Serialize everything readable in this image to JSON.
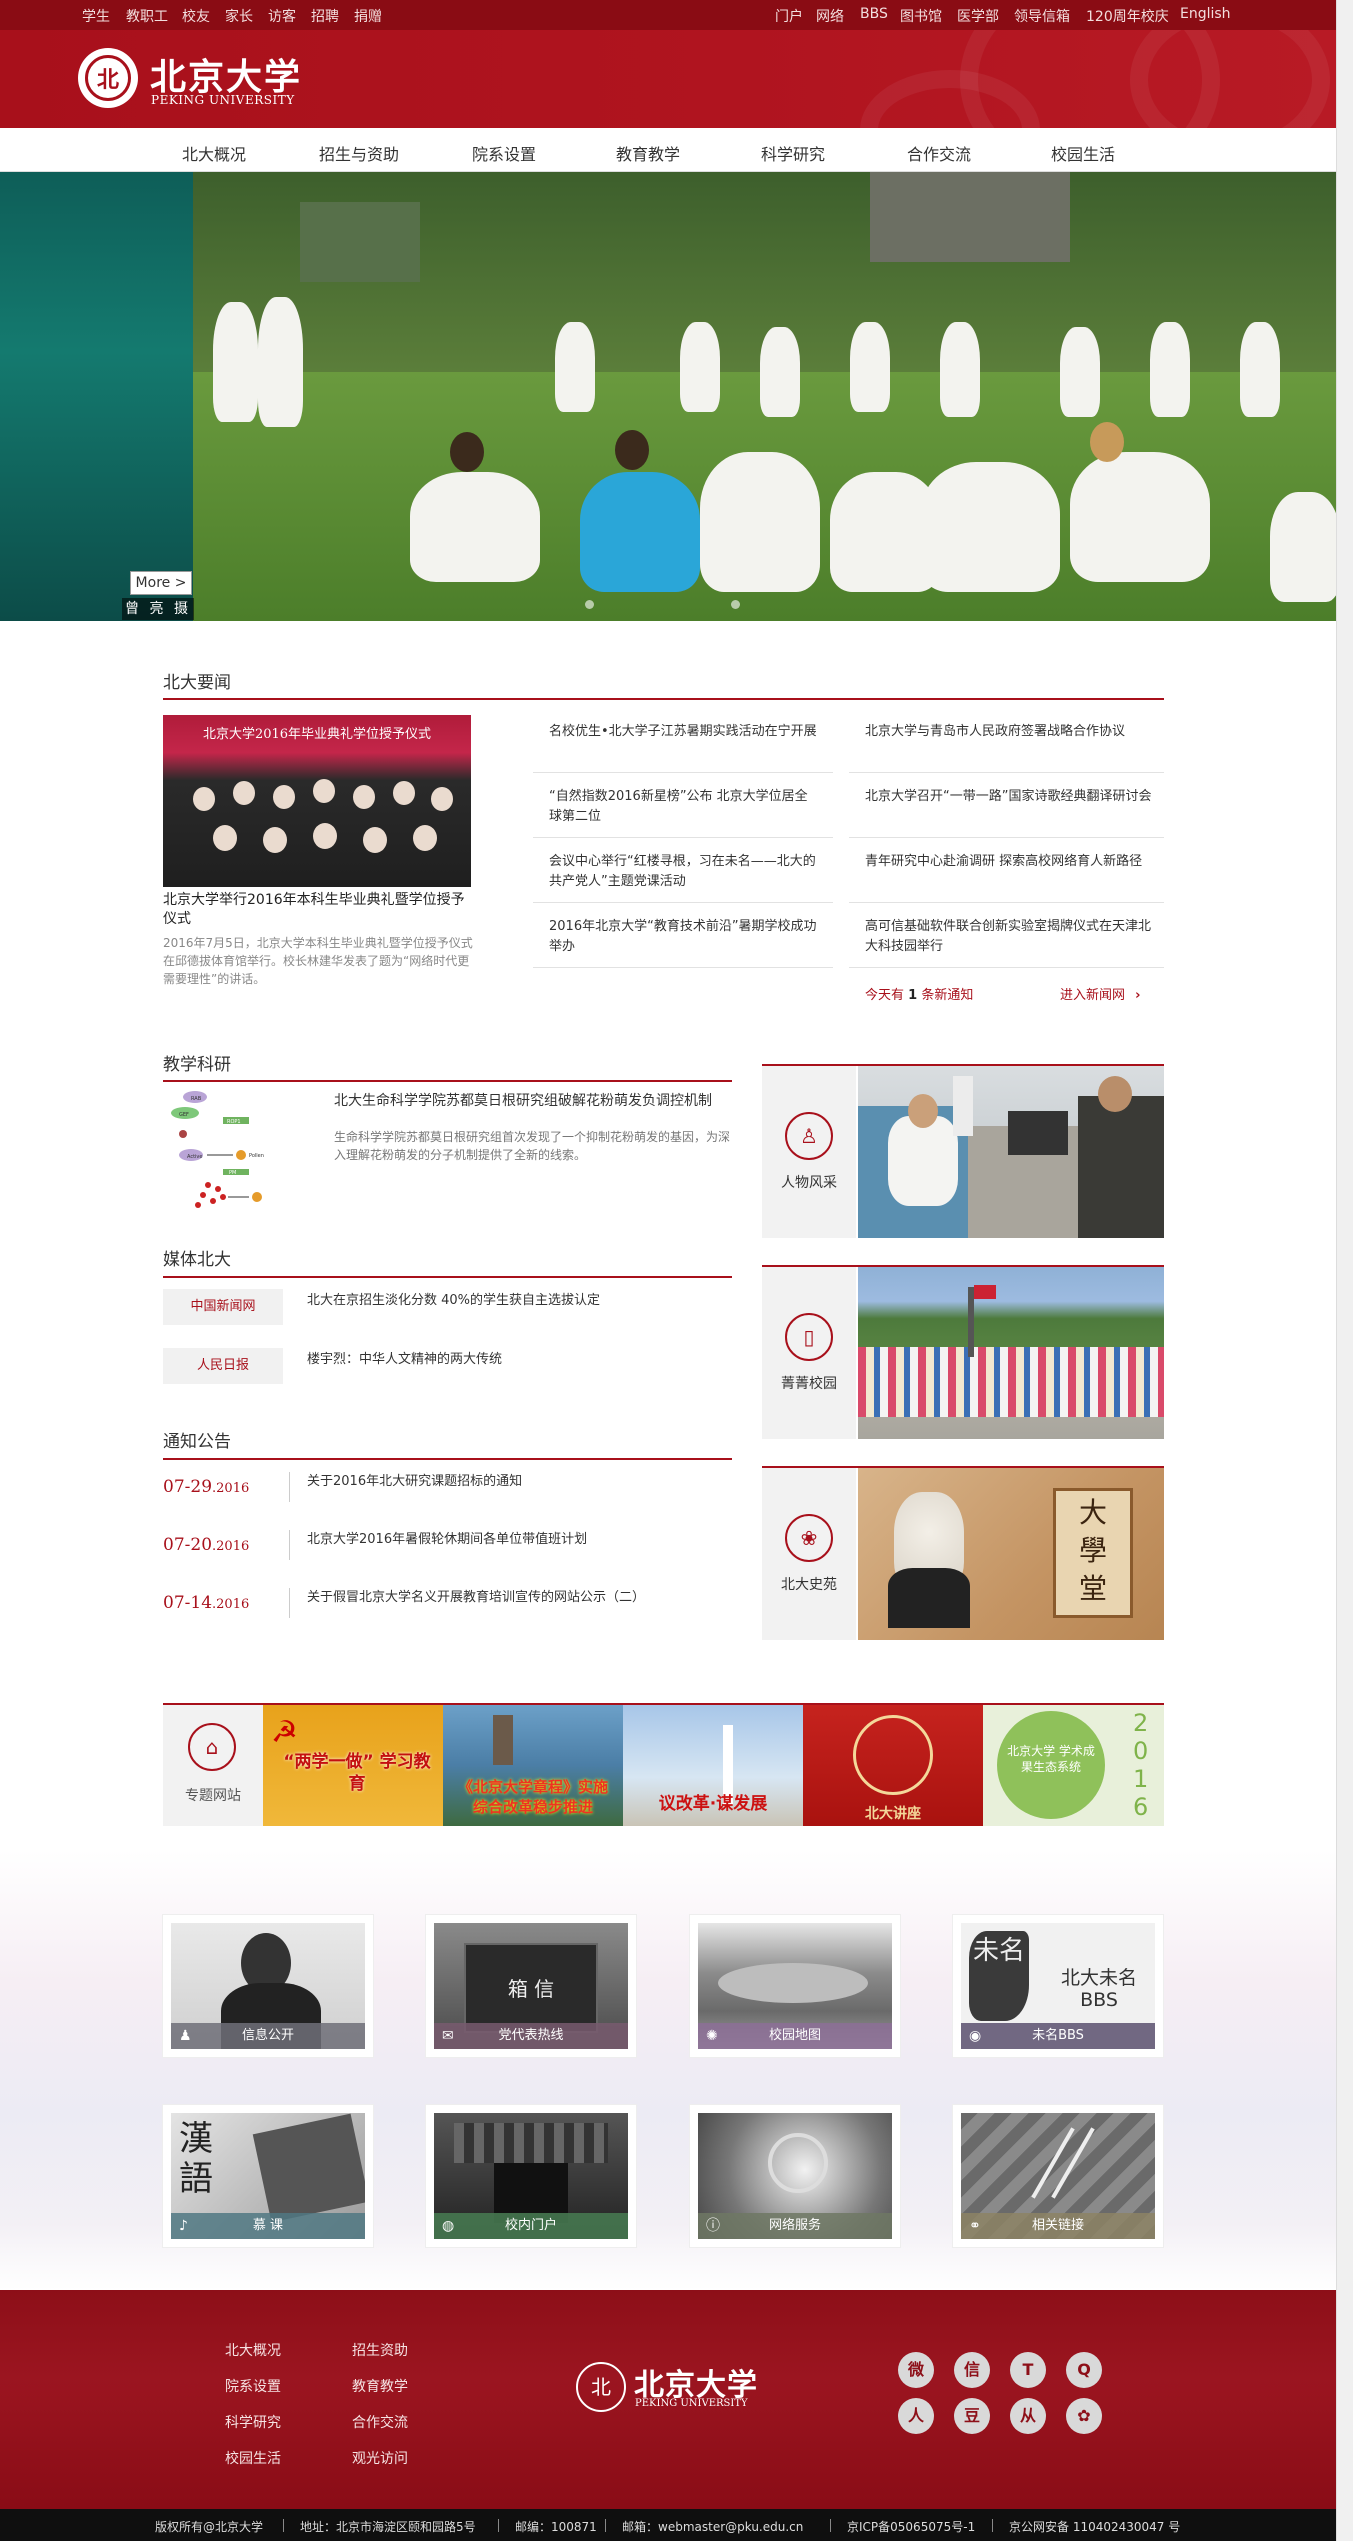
{
  "topbar": {
    "left": [
      "学生",
      "教职工",
      "校友",
      "家长",
      "访客",
      "招聘",
      "捐赠"
    ],
    "right": [
      "门户",
      "网络",
      "BBS",
      "图书馆",
      "医学部",
      "领导信箱",
      "120周年校庆",
      "English"
    ]
  },
  "logo": {
    "cn": "北京大学",
    "en": "PEKING UNIVERSITY",
    "seal": "北"
  },
  "nav": [
    "北大概况",
    "招生与资助",
    "院系设置",
    "教育教学",
    "科学研究",
    "合作交流",
    "校园生活"
  ],
  "banner": {
    "more": "More >",
    "photographer": "曾 亮 摄"
  },
  "news": {
    "title": "北大要闻",
    "image_caption": "北京大学2016年毕业典礼学位授予仪式",
    "lead_title": "北京大学举行2016年本科生毕业典礼暨学位授予仪式",
    "lead_desc": "2016年7月5日，北京大学本科生毕业典礼暨学位授予仪式在邱德拔体育馆举行。校长林建华发表了题为“网络时代更需要理性”的讲话。",
    "items_left": [
      "名校优生•北大学子江苏暑期实践活动在宁开展",
      "“自然指数2016新星榜”公布 北京大学位居全球第二位",
      "会议中心举行“红楼寻根，习在未名——北大的共产党人”主题党课活动",
      "2016年北京大学“教育技术前沿”暑期学校成功举办"
    ],
    "items_right": [
      "北京大学与青岛市人民政府签署战略合作协议",
      "北京大学召开“一带一路”国家诗歌经典翻译研讨会",
      "青年研究中心赴渝调研 探索高校网络育人新路径",
      "高可信基础软件联合创新实验室揭牌仪式在天津北大科技园举行"
    ],
    "today_prefix": "今天有",
    "today_count": "1",
    "today_suffix": "条新通知",
    "enter": "进入新闻网"
  },
  "teaching": {
    "title": "教学科研",
    "item_title": "北大生命科学学院苏都莫日根研究组破解花粉萌发负调控机制",
    "item_desc": "生命科学学院苏都莫日根研究组首次发现了一个抑制花粉萌发的基因，为深入理解花粉萌发的分子机制提供了全新的线索。",
    "diagram_labels": [
      "RAB",
      "GEF",
      "ROP1",
      "Active",
      "Pollen",
      "PM"
    ]
  },
  "media": {
    "title": "媒体北大",
    "items": [
      {
        "tag": "中国新闻网",
        "text": "北大在京招生淡化分数 40%的学生获自主选拔认定"
      },
      {
        "tag": "人民日报",
        "text": "楼宇烈：中华人文精神的两大传统"
      }
    ]
  },
  "notices": {
    "title": "通知公告",
    "items": [
      {
        "md": "07-29",
        "year": ".2016",
        "text": "关于2016年北大研究课题招标的通知"
      },
      {
        "md": "07-20",
        "year": ".2016",
        "text": "北京大学2016年暑假轮休期间各单位带值班计划"
      },
      {
        "md": "07-14",
        "year": ".2016",
        "text": "关于假冒北京大学名义开展教育培训宣传的网站公示（二）"
      }
    ]
  },
  "features": [
    {
      "label": "人物风采",
      "icon": "person-icon"
    },
    {
      "label": "菁菁校园",
      "icon": "book-icon"
    },
    {
      "label": "北大史苑",
      "icon": "seal-icon"
    }
  ],
  "feature_image_text": {
    "plaque": "大學堂"
  },
  "special": {
    "label": "专题网站",
    "banners": [
      {
        "text": "“两学一做” 学习教育"
      },
      {
        "text": "《北京大学章程》实施 综合改革稳步推进"
      },
      {
        "text": "议改革·谋发展"
      },
      {
        "text": "北大讲座"
      },
      {
        "text": "北京大学 学术成果生态系统",
        "year": "2016"
      }
    ]
  },
  "tiles": [
    {
      "label": "信息公开",
      "icon": "person-icon"
    },
    {
      "label": "党代表热线",
      "icon": "mail-icon",
      "sign": "箱 信"
    },
    {
      "label": "校园地图",
      "icon": "map-icon"
    },
    {
      "label": "未名BBS",
      "icon": "bbs-icon",
      "brand": "北大未名",
      "brand2": "BBS",
      "glyph": "未名"
    },
    {
      "label": "慕 课",
      "icon": "bell-icon",
      "glyph": "漢語"
    },
    {
      "label": "校内门户",
      "icon": "globe-icon"
    },
    {
      "label": "网络服务",
      "icon": "info-icon"
    },
    {
      "label": "相关链接",
      "icon": "link-icon"
    }
  ],
  "footer": {
    "col1": [
      "北大概况",
      "院系设置",
      "科学研究",
      "校园生活"
    ],
    "col2": [
      "招生资助",
      "教育教学",
      "合作交流",
      "观光访问"
    ],
    "logo_cn": "北京大学",
    "logo_en": "PEKING UNIVERSITY",
    "social": [
      {
        "name": "weibo-icon",
        "glyph": "微"
      },
      {
        "name": "wechat-icon",
        "glyph": "信"
      },
      {
        "name": "tencent-icon",
        "glyph": "T"
      },
      {
        "name": "qq-icon",
        "glyph": "Q"
      },
      {
        "name": "renren-icon",
        "glyph": "人"
      },
      {
        "name": "douban-icon",
        "glyph": "豆"
      },
      {
        "name": "people-icon",
        "glyph": "从"
      },
      {
        "name": "flower-icon",
        "glyph": "✿"
      }
    ],
    "bottom": [
      "版权所有@北京大学",
      "地址：北京市海淀区颐和园路5号",
      "邮编：100871",
      "邮箱：webmaster@pku.edu.cn",
      "京ICP备05065075号-1",
      "京公网安备 110402430047 号"
    ]
  },
  "colors": {
    "brand": "#a8101b",
    "topbar": "#8a0c14",
    "footer": "#8d0f18"
  }
}
